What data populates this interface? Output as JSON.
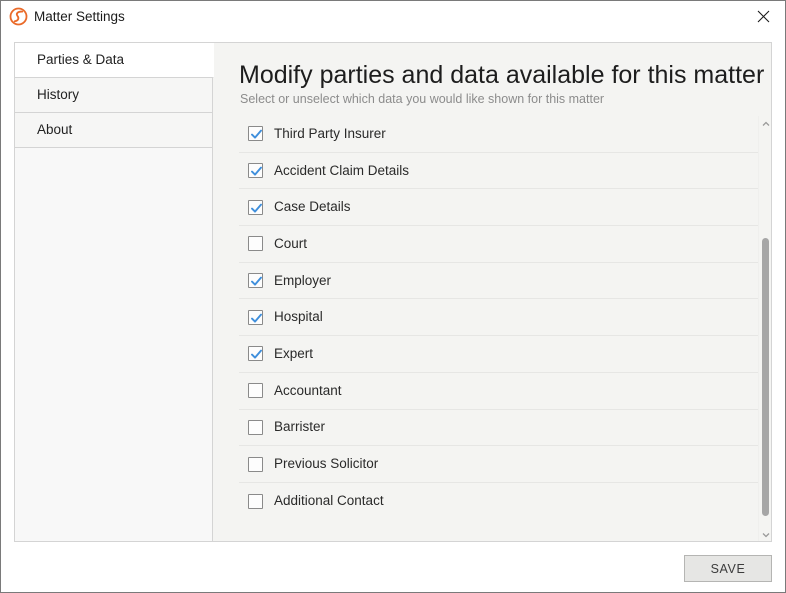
{
  "window": {
    "title": "Matter Settings",
    "app_icon": "smokeball-logo-icon",
    "close_icon": "close-icon"
  },
  "sidebar": {
    "items": [
      {
        "label": "Parties & Data",
        "selected": true
      },
      {
        "label": "History",
        "selected": false
      },
      {
        "label": "About",
        "selected": false
      }
    ]
  },
  "main": {
    "heading": "Modify parties and data available for this matter",
    "subheading": "Select or unselect which data you would like shown for this matter",
    "items": [
      {
        "label": "Third Party Insurer",
        "checked": true
      },
      {
        "label": "Accident Claim Details",
        "checked": true
      },
      {
        "label": "Case Details",
        "checked": true
      },
      {
        "label": "Court",
        "checked": false
      },
      {
        "label": "Employer",
        "checked": true
      },
      {
        "label": "Hospital",
        "checked": true
      },
      {
        "label": "Expert",
        "checked": true
      },
      {
        "label": "Accountant",
        "checked": false
      },
      {
        "label": "Barrister",
        "checked": false
      },
      {
        "label": "Previous Solicitor",
        "checked": false
      },
      {
        "label": "Additional Contact",
        "checked": false
      }
    ]
  },
  "scrollbar": {
    "up_icon": "chevron-up-icon",
    "down_icon": "chevron-down-icon"
  },
  "footer": {
    "save_label": "SAVE"
  },
  "colors": {
    "accent": "#ea6a29",
    "checkmark": "#3f8fdc",
    "panel_bg": "#f4f4f2",
    "border": "#d4d4d4"
  }
}
